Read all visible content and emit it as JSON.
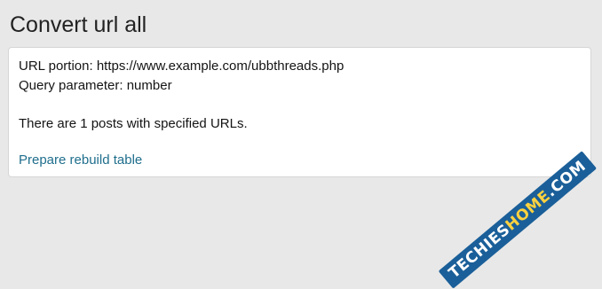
{
  "page": {
    "title": "Convert url all"
  },
  "info": {
    "url_line": "URL portion: https://www.example.com/ubbthreads.php",
    "param_line": "Query parameter: number",
    "count_line": "There are 1 posts with specified URLs.",
    "rebuild_link": "Prepare rebuild table"
  },
  "watermark": {
    "part1": "TECHIES",
    "part2": "HOME",
    "part3": ".COM"
  },
  "colors": {
    "background": "#e8e8e8",
    "link": "#1f6e8c",
    "watermark_bg": "#1a5f99",
    "watermark_accent": "#ffd23f"
  }
}
